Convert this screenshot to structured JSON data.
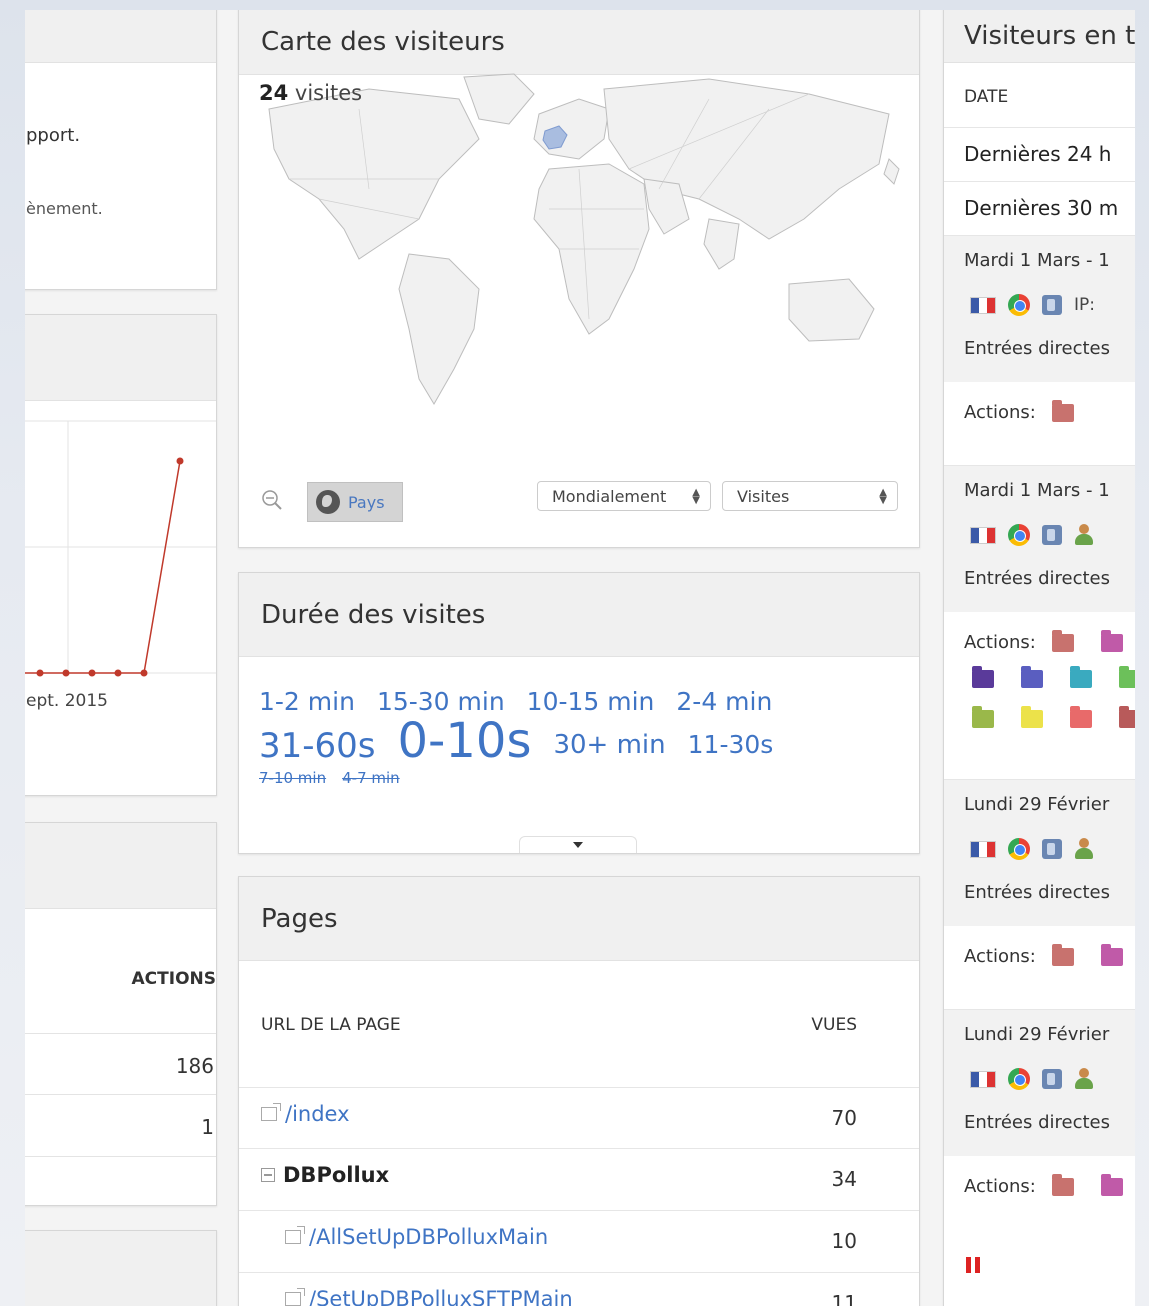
{
  "left_column": {
    "text_1": "pport.",
    "text_2": "ènement.",
    "x_label": "ept. 2015",
    "actions_header": "ACTIONS",
    "rows": [
      "186",
      "1"
    ]
  },
  "visitor_map": {
    "title": "Carte des visiteurs",
    "visits_count": "24",
    "visits_label": "visites",
    "pays_button": "Pays",
    "scope_select": "Mondialement",
    "metric_select": "Visites"
  },
  "visit_duration": {
    "title": "Durée des visites",
    "row1": [
      "1-2 min",
      "15-30 min",
      "10-15 min",
      "2-4 min"
    ],
    "row2": [
      "31-60s",
      "0-10s",
      "30+ min",
      "11-30s"
    ],
    "row3": [
      "7-10 min",
      "4-7 min"
    ]
  },
  "pages": {
    "title": "Pages",
    "col_url": "URL DE LA PAGE",
    "col_views": "VUES",
    "rows": [
      {
        "label": "/index",
        "value": "70"
      },
      {
        "label": "DBPollux",
        "value": "34"
      },
      {
        "label": "/AllSetUpDBPolluxMain",
        "value": "10"
      },
      {
        "label": "/SetUpDBPolluxSFTPMain",
        "value": "11"
      }
    ]
  },
  "realtime": {
    "title": "Visiteurs en t",
    "date_header": "DATE",
    "periods": [
      "Dernières 24 h",
      "Dernières 30 m"
    ],
    "visits": [
      {
        "date": "Mardi 1 Mars - 1",
        "ip": "IP:",
        "entry": "Entrées directes",
        "actions_label": "Actions:"
      },
      {
        "date": "Mardi 1 Mars - 1",
        "entry": "Entrées directes",
        "actions_label": "Actions:"
      },
      {
        "date": "Lundi 29 Février",
        "entry": "Entrées directes",
        "actions_label": "Actions:"
      },
      {
        "date": "Lundi 29 Février",
        "entry": "Entrées directes",
        "actions_label": "Actions:"
      }
    ]
  },
  "colors": {
    "link": "#3f74c4",
    "chart_line": "#c0392b",
    "map_highlight": "#a9bde0"
  },
  "chart_data": {
    "type": "line",
    "x": [
      1,
      2,
      3,
      4,
      5,
      6,
      7
    ],
    "values": [
      0,
      0,
      0,
      0,
      0,
      0,
      1
    ],
    "xlabel": "ept. 2015",
    "grid": true
  }
}
